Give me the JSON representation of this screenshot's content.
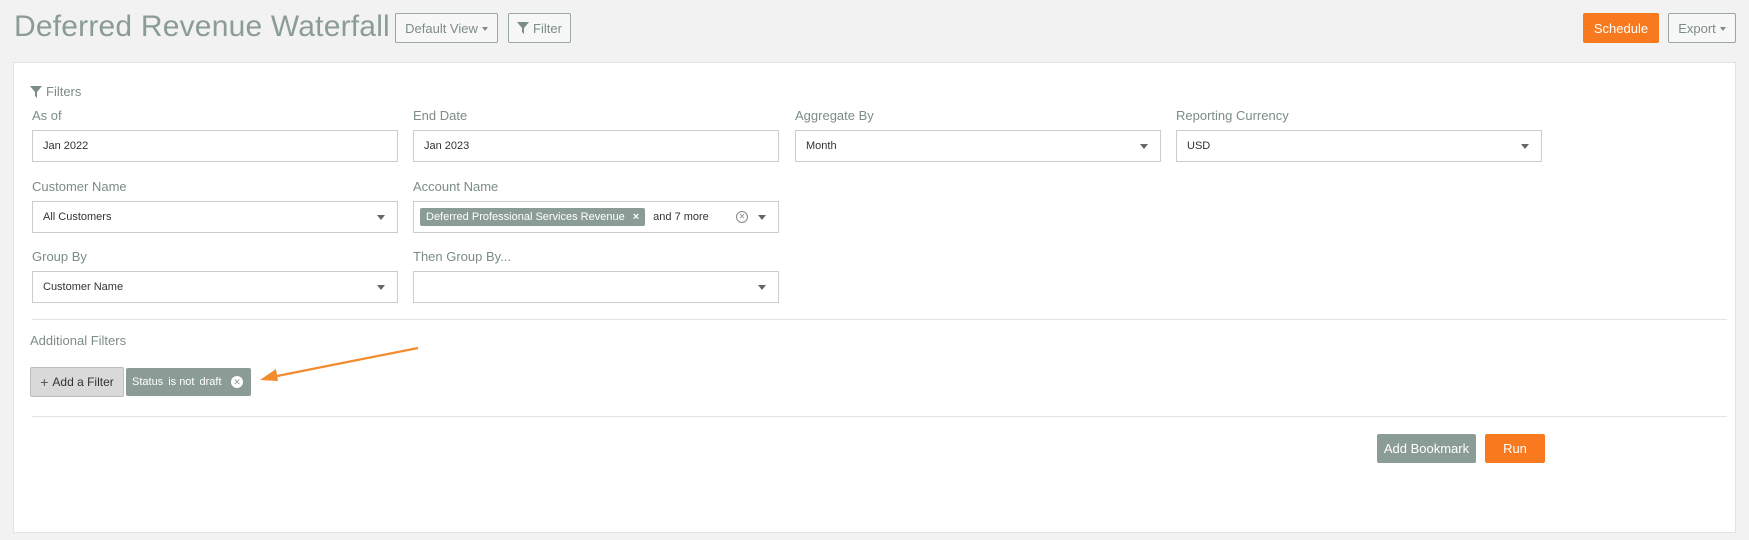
{
  "header": {
    "title": "Deferred Revenue Waterfall",
    "default_view_label": "Default View",
    "filter_label": "Filter",
    "schedule_label": "Schedule",
    "export_label": "Export"
  },
  "filters": {
    "heading": "Filters",
    "as_of": {
      "label": "As of",
      "value": "Jan 2022"
    },
    "end_date": {
      "label": "End Date",
      "value": "Jan 2023"
    },
    "aggregate_by": {
      "label": "Aggregate By",
      "value": "Month"
    },
    "reporting_currency": {
      "label": "Reporting Currency",
      "value": "USD"
    },
    "customer_name": {
      "label": "Customer Name",
      "value": "All Customers"
    },
    "account_name": {
      "label": "Account Name",
      "chip": "Deferred Professional Services Revenue",
      "more": "and 7 more"
    },
    "group_by": {
      "label": "Group By",
      "value": "Customer Name"
    },
    "then_group_by": {
      "label": "Then Group By...",
      "value": ""
    }
  },
  "additional_filters": {
    "heading": "Additional Filters",
    "add_label": "Add a Filter",
    "status_pill": {
      "field": "Status",
      "op": "is not",
      "value": "draft"
    }
  },
  "actions": {
    "bookmark_label": "Add Bookmark",
    "run_label": "Run"
  },
  "colors": {
    "accent_orange": "#f97a1e",
    "muted_green_gray": "#8a9c95"
  }
}
